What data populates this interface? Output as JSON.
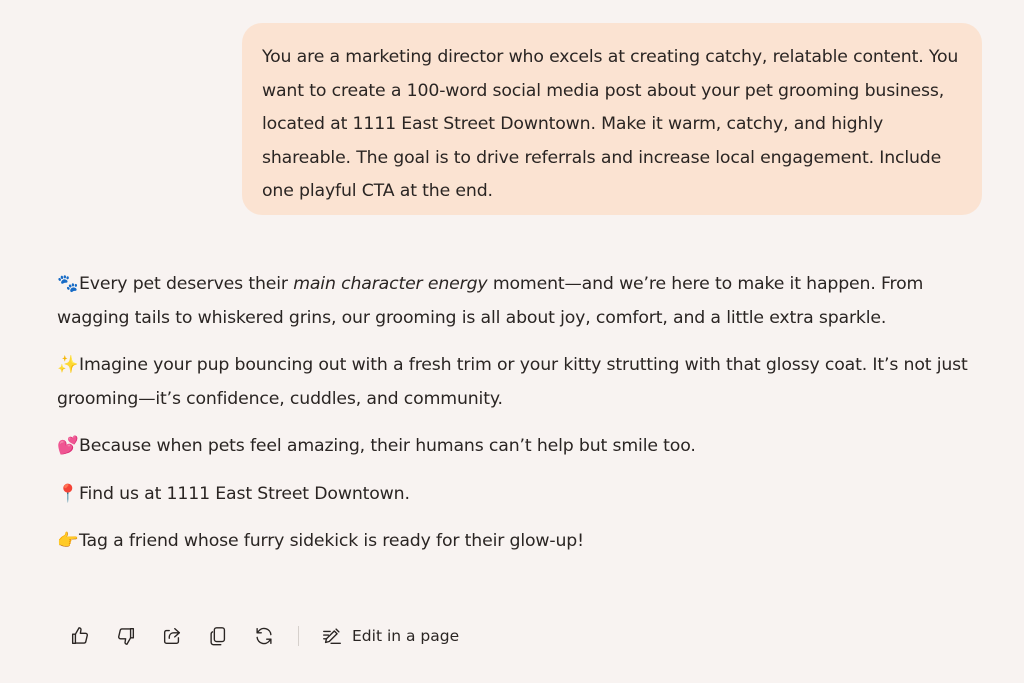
{
  "user_message": {
    "text": "You are a marketing director who excels at creating catchy, relatable content. You want to create a 100-word social media post about your pet grooming business, located at 1111 East Street Downtown. Make it warm, catchy, and highly shareable. The goal is to drive referrals and increase local engagement. Include one playful CTA at the end."
  },
  "response": {
    "p1": {
      "emoji": "🐾",
      "before": "Every pet deserves their ",
      "emphasis": "main character energy",
      "after": " moment—and we’re here to make it happen. From wagging tails to whiskered grins, our grooming is all about joy, comfort, and a little extra sparkle."
    },
    "p2": {
      "emoji": "✨",
      "text": "Imagine your pup bouncing out with a fresh trim or your kitty strutting with that glossy coat. It’s not just grooming—it’s confidence, cuddles, and community."
    },
    "p3": {
      "emoji": "💕",
      "text": "Because when pets feel amazing, their humans can’t help but smile too."
    },
    "p4": {
      "emoji": "📍",
      "text": "Find us at 1111 East Street Downtown."
    },
    "p5": {
      "emoji": "👉",
      "text": "Tag a friend whose furry sidekick is ready for their glow-up!"
    }
  },
  "toolbar": {
    "edit_label": "Edit in a page"
  },
  "icons": {
    "like": "thumbs-up-icon",
    "dislike": "thumbs-down-icon",
    "share": "share-icon",
    "copy": "copy-icon",
    "regenerate": "regenerate-icon",
    "edit": "edit-page-icon"
  },
  "colors": {
    "background": "#f8f3f1",
    "user_bubble": "#fbe3d2",
    "text": "#2a2523"
  }
}
